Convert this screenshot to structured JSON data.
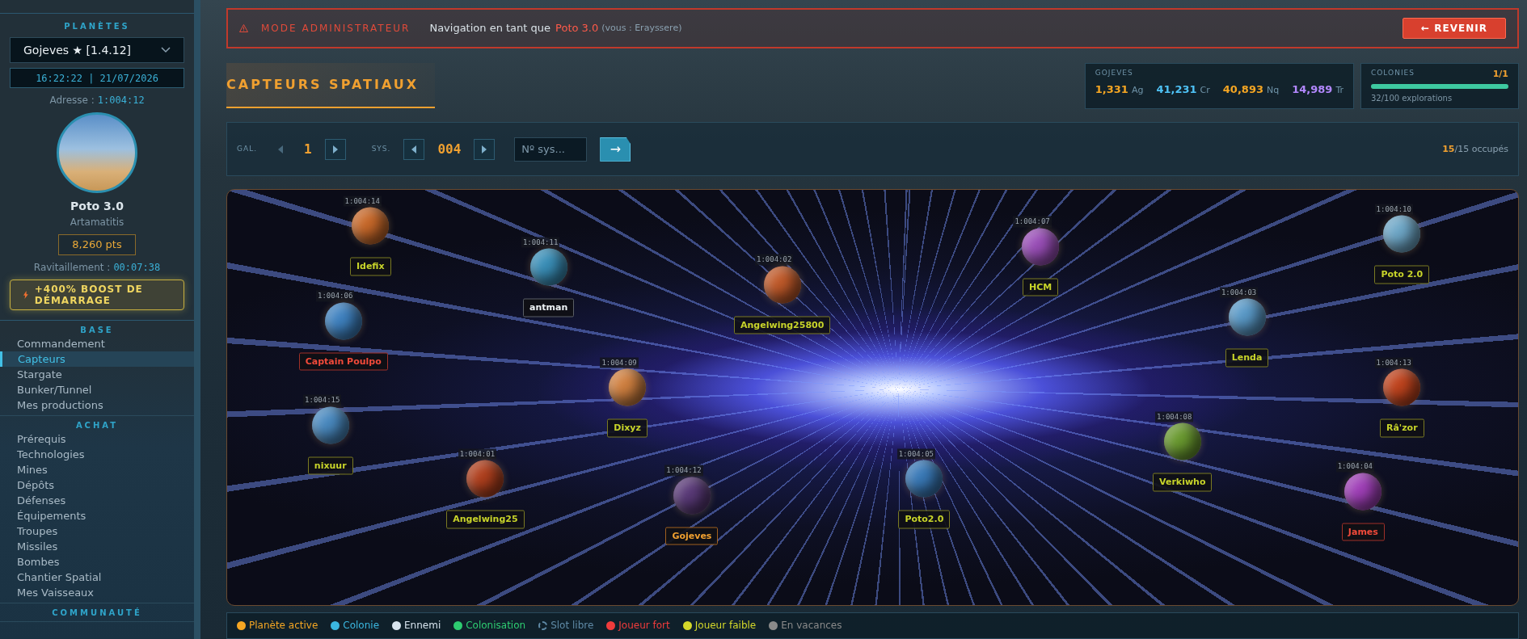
{
  "sidebar": {
    "planets_title": "PLANÈTES",
    "planet_select": "Gojeves ★ [1.4.12]",
    "clock": "16:22:22 | 21/07/2026",
    "address_label": "Adresse :",
    "address": "1:004:12",
    "player_name": "Poto 3.0",
    "player_alliance": "Artamatitis",
    "points": "8,260 pts",
    "resupply_label": "Ravitaillement :",
    "resupply_time": "00:07:38",
    "boost": "+400% BOOST DE DÉMARRAGE",
    "sections": [
      {
        "title": "BASE",
        "items": [
          {
            "label": "Commandement",
            "selected": false
          },
          {
            "label": "Capteurs",
            "selected": true
          },
          {
            "label": "Stargate",
            "selected": false
          },
          {
            "label": "Bunker/Tunnel",
            "selected": false
          },
          {
            "label": "Mes productions",
            "selected": false
          }
        ]
      },
      {
        "title": "ACHAT",
        "items": [
          {
            "label": "Prérequis",
            "selected": false
          },
          {
            "label": "Technologies",
            "selected": false
          },
          {
            "label": "Mines",
            "selected": false
          },
          {
            "label": "Dépôts",
            "selected": false
          },
          {
            "label": "Défenses",
            "selected": false
          },
          {
            "label": "Équipements",
            "selected": false
          },
          {
            "label": "Troupes",
            "selected": false
          },
          {
            "label": "Missiles",
            "selected": false
          },
          {
            "label": "Bombes",
            "selected": false
          },
          {
            "label": "Chantier Spatial",
            "selected": false
          },
          {
            "label": "Mes Vaisseaux",
            "selected": false
          }
        ]
      },
      {
        "title": "COMMUNAUTÉ"
      }
    ]
  },
  "admin_banner": {
    "title": "MODE ADMINISTRATEUR",
    "message": "Navigation en tant que",
    "user": "Poto 3.0",
    "note": "(vous : Erayssere)",
    "button": "← REVENIR"
  },
  "page_title": "CAPTEURS SPATIAUX",
  "resources": {
    "planet": "GOJEVES",
    "items": [
      {
        "value": "1,331",
        "unit": "Ag",
        "color": "#f5a623"
      },
      {
        "value": "41,231",
        "unit": "Cr",
        "color": "#4fc3f7"
      },
      {
        "value": "40,893",
        "unit": "Nq",
        "color": "#f5a623"
      },
      {
        "value": "14,989",
        "unit": "Tr",
        "color": "#b388ff"
      }
    ]
  },
  "colonies": {
    "title": "COLONIES",
    "count": "1/1",
    "level": 1,
    "explorations": "32/100 explorations"
  },
  "navigator": {
    "galaxy_label": "GAL.",
    "galaxy": "1",
    "galaxy_prev_disabled": true,
    "galaxy_next_disabled": false,
    "system_label": "SYS.",
    "system": "004",
    "system_prev_disabled": false,
    "system_next_disabled": false,
    "search_placeholder": "Nº sys...",
    "go_button": "→",
    "occupied": "15",
    "occupied_total": "/15 occupés"
  },
  "planets": [
    {
      "address": "1:004:14",
      "player": "Idefix",
      "kind": "weak",
      "color": "#c8692a"
    },
    {
      "address": "1:004:11",
      "player": "antman",
      "kind": "enemy",
      "color": "#3a8fb8"
    },
    {
      "address": "1:004:02",
      "player": "Angelwing25800",
      "kind": "weak",
      "color": "#c05a2a"
    },
    {
      "address": "1:004:07",
      "player": "HCM",
      "kind": "weak",
      "color": "#9a4fb8"
    },
    {
      "address": "1:004:10",
      "player": "Poto 2.0",
      "kind": "weak",
      "color": "#6fa8c8"
    },
    {
      "address": "1:004:06",
      "player": "Captain Poulpo",
      "kind": "strong",
      "color": "#3f82c0"
    },
    {
      "address": "1:004:03",
      "player": "Lenda",
      "kind": "weak",
      "color": "#5a9ac8"
    },
    {
      "address": "1:004:09",
      "player": "Dixyz",
      "kind": "weak",
      "color": "#d08040"
    },
    {
      "address": "1:004:13",
      "player": "Râ'zor",
      "kind": "weak",
      "color": "#c0441e"
    },
    {
      "address": "1:004:15",
      "player": "nixuur",
      "kind": "weak",
      "color": "#4a8ac0"
    },
    {
      "address": "1:004:08",
      "player": "Verkiwho",
      "kind": "weak",
      "color": "#6a9a30"
    },
    {
      "address": "1:004:01",
      "player": "Angelwing25",
      "kind": "weak",
      "color": "#b0401e"
    },
    {
      "address": "1:004:12",
      "player": "Gojeves",
      "kind": "active",
      "color": "#5a3a78"
    },
    {
      "address": "1:004:05",
      "player": "Poto2.0",
      "kind": "weak",
      "color": "#3a7ab8"
    },
    {
      "address": "1:004:04",
      "player": "James",
      "kind": "strong",
      "color": "#a040b8"
    }
  ],
  "legend": [
    {
      "label": "Planète active",
      "kind": "dot",
      "color": "#f5a623"
    },
    {
      "label": "Colonie",
      "kind": "dot",
      "color": "#3bb7e0"
    },
    {
      "label": "Ennemi",
      "kind": "dot",
      "color": "#d8e4ee"
    },
    {
      "label": "Colonisation",
      "kind": "dot",
      "color": "#2ecc71"
    },
    {
      "label": "Slot libre",
      "kind": "dashed",
      "color": "#5f8aa6"
    },
    {
      "label": "Joueur fort",
      "kind": "dot",
      "color": "#f03c3c"
    },
    {
      "label": "Joueur faible",
      "kind": "dot",
      "color": "#d4d82a"
    },
    {
      "label": "En vacances",
      "kind": "dot",
      "color": "#8a8a8a"
    }
  ]
}
